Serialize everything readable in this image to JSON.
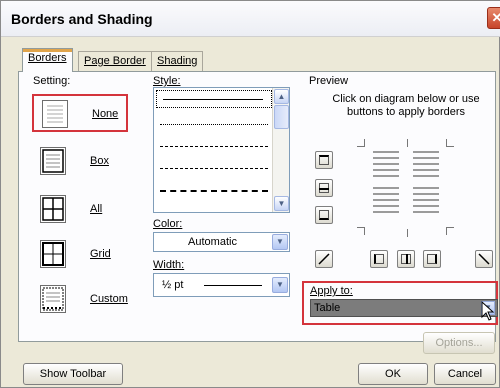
{
  "dialog": {
    "title": "Borders and Shading",
    "close_symbol": "✕"
  },
  "tabs": [
    {
      "label": "Borders",
      "active": true
    },
    {
      "label": "Page Border",
      "active": false
    },
    {
      "label": "Shading",
      "active": false
    }
  ],
  "setting": {
    "label": "Setting:",
    "items": [
      {
        "name": "None",
        "icon": "border-none-icon",
        "selected": true
      },
      {
        "name": "Box",
        "icon": "border-box-icon",
        "selected": false
      },
      {
        "name": "All",
        "icon": "border-all-icon",
        "selected": false
      },
      {
        "name": "Grid",
        "icon": "border-grid-icon",
        "selected": false
      },
      {
        "name": "Custom",
        "icon": "border-custom-icon",
        "selected": false
      }
    ]
  },
  "style": {
    "label": "Style:",
    "line_styles": [
      "solid",
      "dotted",
      "dash-dot",
      "dashed",
      "long-dashed"
    ]
  },
  "color": {
    "label": "Color:",
    "value": "Automatic"
  },
  "width": {
    "label": "Width:",
    "value": "½ pt"
  },
  "preview": {
    "label": "Preview",
    "hint": "Click on diagram below or use buttons to apply borders"
  },
  "apply_to": {
    "label": "Apply to:",
    "value": "Table"
  },
  "buttons": {
    "options": "Options...",
    "show_toolbar": "Show Toolbar",
    "ok": "OK",
    "cancel": "Cancel"
  },
  "colors": {
    "highlight_red": "#d4343c",
    "tab_accent": "#e0a44b",
    "dialog_bg": "#ece9d8"
  }
}
